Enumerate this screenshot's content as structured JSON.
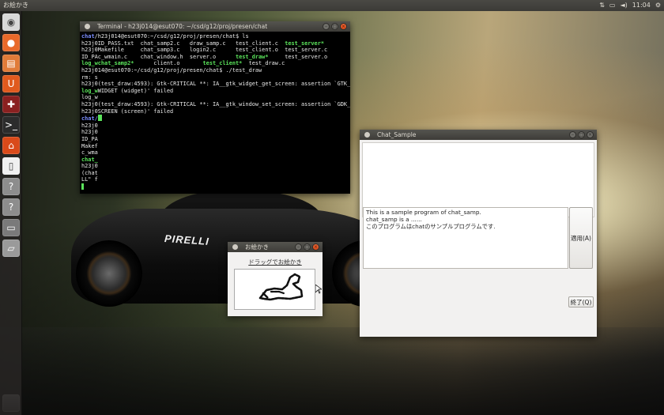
{
  "top_panel": {
    "app_title": "お絵かき",
    "time": "11:04"
  },
  "launcher": {
    "items": [
      {
        "name": "ubuntu-dash-icon",
        "glyph": "◉",
        "color": "#d8d8d8"
      },
      {
        "name": "firefox-icon",
        "glyph": "●",
        "color": "#e8692a"
      },
      {
        "name": "files-icon",
        "glyph": "▤",
        "color": "#e07b39"
      },
      {
        "name": "ubuntu-software-icon",
        "glyph": "U",
        "color": "#e05a1e"
      },
      {
        "name": "settings-icon",
        "glyph": "✚",
        "color": "#8a2020"
      },
      {
        "name": "terminal-icon",
        "glyph": ">_",
        "color": "#2c2c2c"
      },
      {
        "name": "ubuntu-one-icon",
        "glyph": "⌂",
        "color": "#d94a1a"
      },
      {
        "name": "document-icon",
        "glyph": "▯",
        "color": "#f0f0f0"
      },
      {
        "name": "unknown-app-icon-1",
        "glyph": "?",
        "color": "#8d8d8d"
      },
      {
        "name": "unknown-app-icon-2",
        "glyph": "?",
        "color": "#8d8d8d"
      },
      {
        "name": "window-app-icon",
        "glyph": "▭",
        "color": "#7a7a7a"
      },
      {
        "name": "drive-icon",
        "glyph": "▱",
        "color": "#9a9a9a"
      }
    ]
  },
  "terminal": {
    "title": "Terminal - h23j014@esut070: ~/csd/g12/proj/presen/chat",
    "prompt_user": "chat",
    "lines": {
      "l1": "/h23j014@esut070:~/csd/g12/proj/presen/chat$ ls",
      "l2a": "h23j0ID_PASS.txt  chat_samp2.c   draw_samp.c   test_client.c  ",
      "l2b": "test_server*",
      "l3": "h23j0Makefile     chat_samp3.c   login2.c      test_client.o  test_server.c",
      "l4a": "ID_PAc_wmain.c    chat_window.h  server.o      ",
      "l4b": "test_draw*",
      "l4c": "     test_server.o",
      "l5a": "log_w",
      "l5b": "chat_samp2*",
      "l5c": "      client.o       ",
      "l5d": "test_client*",
      "l5e": "  test_draw.c",
      "l6": "h23j014@esut070:~/csd/g12/proj/presen/chat$ ./test_draw",
      "l7": "rm: s",
      "l8": "h23j0(test_draw:4593): Gtk-CRITICAL **: IA__gtk_widget_get_screen: assertion `GTK_IS",
      "l9a": "log_w",
      "l9b": "WIDGET (widget)' failed",
      "l10": "log_w",
      "l11": "h23j0(test_draw:4593): Gtk-CRITICAL **: IA__gtk_window_set_screen: assertion `GDK_IS",
      "l12": "h23j0SCREEN (screen)' failed",
      "l13": "chat/",
      "l14": "h23j0",
      "l15": "h23j0",
      "l16": "ID_PA",
      "l17": "Makef",
      "l18": "c_wma",
      "l19": "chat_",
      "l20": "h23j0",
      "l21": "",
      "l22": "(chat",
      "l23": "LL\" f"
    }
  },
  "chat_window": {
    "title": "Chat_Sample",
    "text_lines": [
      "This is a sample program of chat_samp.",
      "chat_samp is a ......",
      "このプログラムはchatのサンプルプログラムです."
    ],
    "apply_label": "適用(A)",
    "quit_label": "終了(Q)"
  },
  "oekaki_window": {
    "title": "お絵かき",
    "drag_label": "ドラッグでお絵かき"
  }
}
